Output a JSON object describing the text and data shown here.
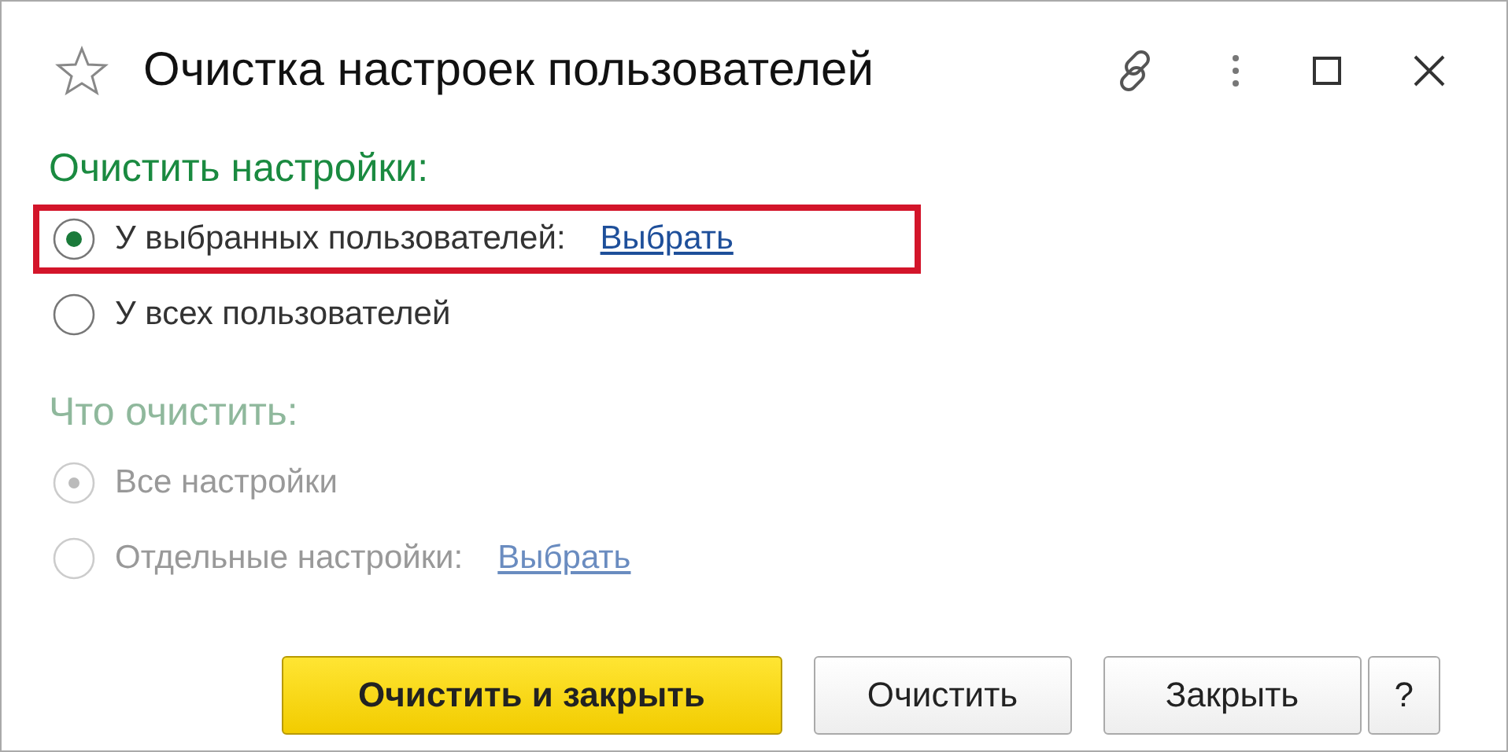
{
  "window": {
    "title": "Очистка настроек пользователей",
    "favorite": false
  },
  "sections": [
    {
      "heading": "Очистить настройки:",
      "disabled": false,
      "options": [
        {
          "label": "У выбранных пользователей:",
          "selected": true,
          "highlighted": true,
          "link": "Выбрать"
        },
        {
          "label": "У всех пользователей",
          "selected": false,
          "highlighted": false
        }
      ]
    },
    {
      "heading": "Что очистить:",
      "disabled": true,
      "options": [
        {
          "label": "Все настройки",
          "selected": true,
          "highlighted": false
        },
        {
          "label": "Отдельные настройки:",
          "selected": false,
          "highlighted": false,
          "link": "Выбрать"
        }
      ]
    }
  ],
  "buttons": [
    {
      "label": "Очистить и закрыть",
      "kind": "primary"
    },
    {
      "label": "Очистить",
      "kind": "normal"
    },
    {
      "label": "Закрыть",
      "kind": "normal"
    },
    {
      "label": "?",
      "kind": "help"
    }
  ]
}
